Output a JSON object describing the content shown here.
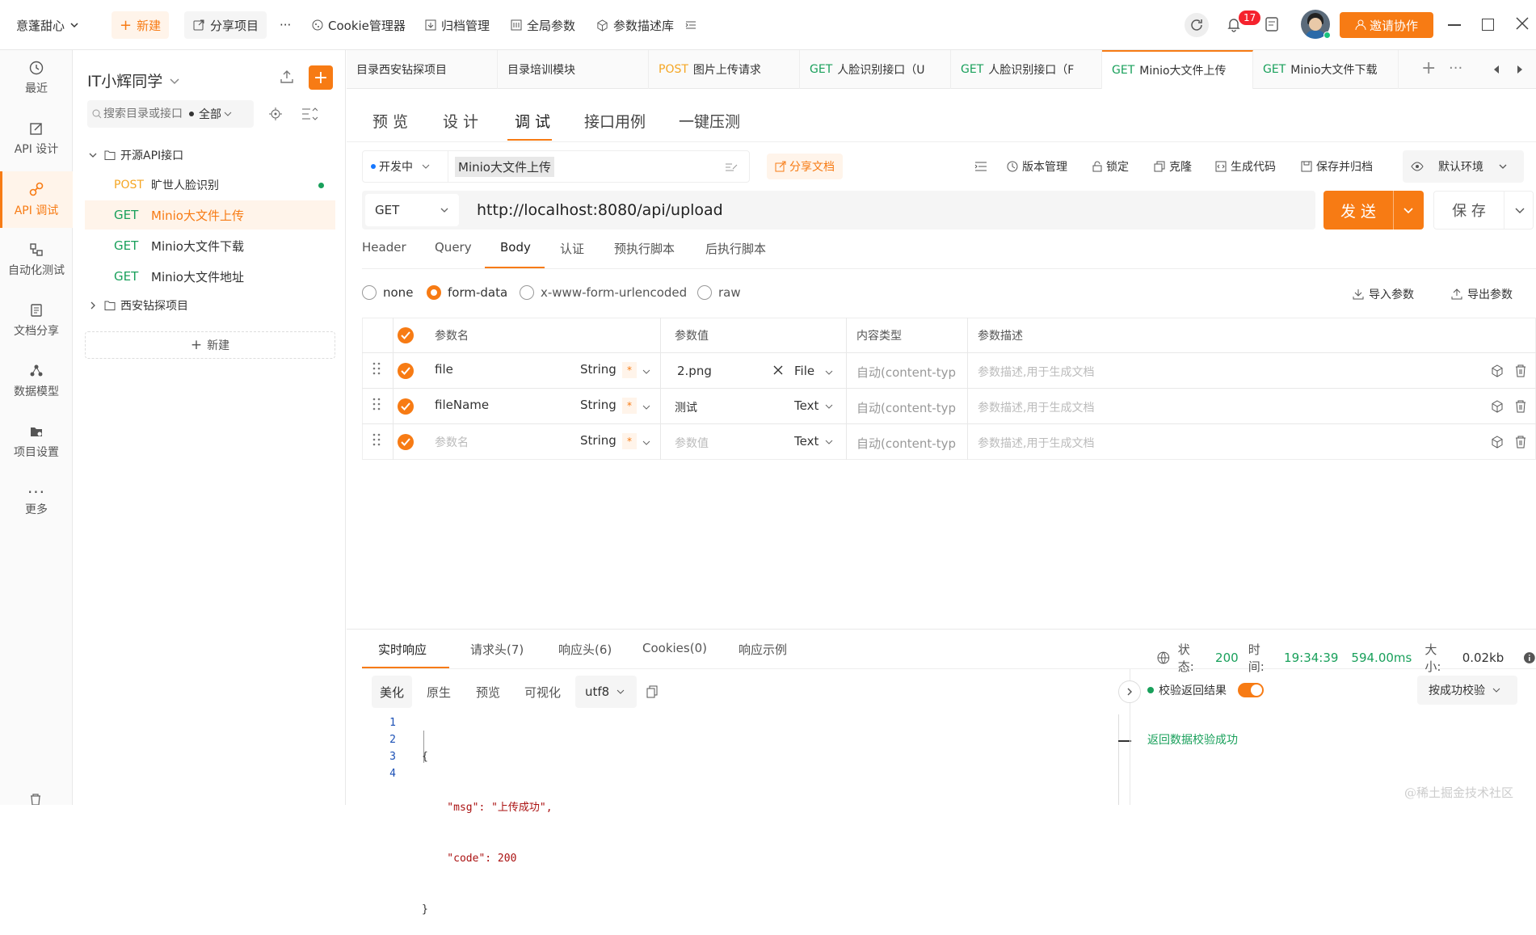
{
  "topbar": {
    "workspace": "意蓬甜心",
    "new_label": "新建",
    "share_label": "分享项目",
    "more_label": "···",
    "cookie_label": "Cookie管理器",
    "archive_label": "归档管理",
    "global_params_label": "全局参数",
    "param_lib_label": "参数描述库",
    "notification_count": "17",
    "invite_label": "邀请协作"
  },
  "rail": [
    {
      "label": "最近",
      "icon": "clock-icon"
    },
    {
      "label": "API 设计",
      "icon": "edit-icon"
    },
    {
      "label": "API 调试",
      "icon": "debug-icon",
      "active": true
    },
    {
      "label": "自动化测试",
      "icon": "flow-icon"
    },
    {
      "label": "文档分享",
      "icon": "doc-icon"
    },
    {
      "label": "数据模型",
      "icon": "model-icon"
    },
    {
      "label": "项目设置",
      "icon": "folder-gear-icon"
    },
    {
      "label": "更多",
      "icon": "more-icon"
    }
  ],
  "tree": {
    "project_name": "IT小辉同学",
    "search_placeholder": "搜索目录或接口",
    "filter_label": "全部",
    "folder1": "开源API接口",
    "folder2": "西安钻探项目",
    "new_label": "新建",
    "items": [
      {
        "method": "POST",
        "name": "旷世人脸识别",
        "dot": true
      },
      {
        "method": "GET",
        "name": "Minio大文件上传",
        "selected": true
      },
      {
        "method": "GET",
        "name": "Minio大文件下载"
      },
      {
        "method": "GET",
        "name": "Minio大文件地址"
      }
    ]
  },
  "tabs": [
    {
      "method": "",
      "name": "目录西安钻探项目"
    },
    {
      "method": "",
      "name": "目录培训模块"
    },
    {
      "method": "POST",
      "name": "图片上传请求"
    },
    {
      "method": "GET",
      "name": "人脸识别接口（U"
    },
    {
      "method": "GET",
      "name": "人脸识别接口（F"
    },
    {
      "method": "GET",
      "name": "Minio大文件上传",
      "active": true
    },
    {
      "method": "GET",
      "name": "Minio大文件下载"
    }
  ],
  "main_tabs": [
    "预 览",
    "设 计",
    "调 试",
    "接口用例",
    "一键压测"
  ],
  "status_label": "开发中",
  "api_name": "Minio大文件上传",
  "share_doc_label": "分享文档",
  "actions": {
    "version": "版本管理",
    "lock": "锁定",
    "clone": "克隆",
    "gen_code": "生成代码",
    "save_archive": "保存并归档",
    "env": "默认环境"
  },
  "request": {
    "method": "GET",
    "url": "http://localhost:8080/api/upload",
    "send_label": "发 送",
    "save_label": "保 存"
  },
  "sub_tabs": [
    "Header",
    "Query",
    "Body",
    "认证",
    "预执行脚本",
    "后执行脚本"
  ],
  "body_types": [
    "none",
    "form-data",
    "x-www-form-urlencoded",
    "raw"
  ],
  "import_label": "导入参数",
  "export_label": "导出参数",
  "table": {
    "headers": [
      "参数名",
      "参数值",
      "内容类型",
      "参数描述"
    ],
    "rows": [
      {
        "name": "file",
        "type": "String",
        "required": "*",
        "value": "2.png",
        "value_type": "File",
        "content_type": "自动(content-typ",
        "desc": "参数描述,用于生成文档",
        "placeholder_name": false,
        "placeholder_value": false
      },
      {
        "name": "fileName",
        "type": "String",
        "required": "*",
        "value": "测试",
        "value_type": "Text",
        "content_type": "自动(content-typ",
        "desc": "参数描述,用于生成文档",
        "placeholder_name": false,
        "placeholder_value": false
      },
      {
        "name": "参数名",
        "type": "String",
        "required": "*",
        "value": "参数值",
        "value_type": "Text",
        "content_type": "自动(content-typ",
        "desc": "参数描述,用于生成文档",
        "placeholder_name": true,
        "placeholder_value": true
      }
    ]
  },
  "response": {
    "tabs": [
      "实时响应",
      "请求头(7)",
      "响应头(6)",
      "Cookies(0)",
      "响应示例"
    ],
    "status_label": "状态:",
    "status": "200",
    "time_label": "时间:",
    "time": "19:34:39",
    "duration": "594.00ms",
    "size_label": "大小:",
    "size": "0.02kb",
    "view_tabs": [
      "美化",
      "原生",
      "预览",
      "可视化"
    ],
    "encoding": "utf8",
    "code_lines": [
      "{",
      "    \"msg\": \"上传成功\",",
      "    \"code\": 200",
      "}"
    ],
    "validate_label": "校验返回结果",
    "validate_mode": "按成功校验",
    "validate_result": "返回数据校验成功"
  },
  "watermark": "@稀土掘金技术社区",
  "colors": {
    "accent": "#f77b14",
    "get": "#19a05b",
    "post": "#f5a623"
  }
}
